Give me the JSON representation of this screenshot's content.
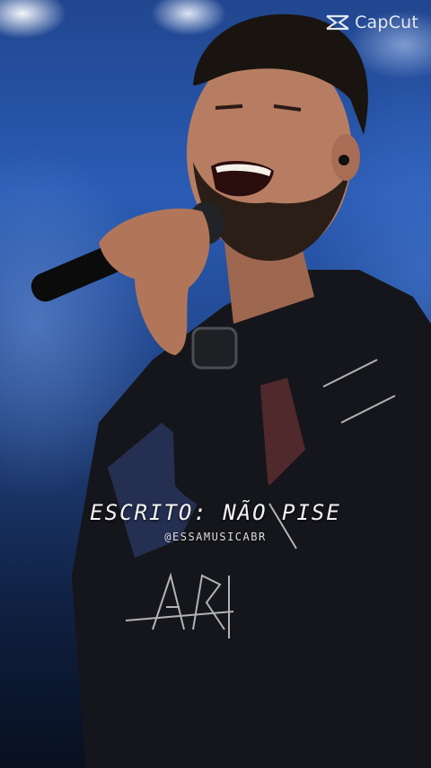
{
  "watermark": {
    "brand": "CapCut",
    "icon": "capcut-logo-icon"
  },
  "caption": {
    "title": "ESCRITO: NÃO PISE",
    "handle": "@ESSAMUSICABR"
  },
  "colors": {
    "stage_blue": "#2a5cb5",
    "shirt": "#15161b",
    "skin": "#b77d62",
    "text": "#f4f4f4"
  }
}
